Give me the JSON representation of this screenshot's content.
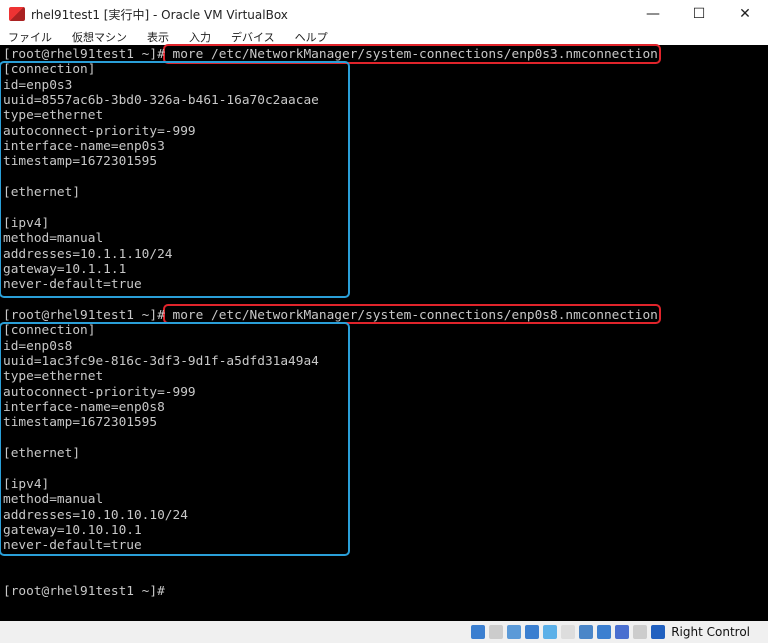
{
  "window": {
    "title": "rhel91test1 [実行中] - Oracle VM VirtualBox",
    "minimize": "—",
    "maximize": "☐",
    "close": "✕"
  },
  "menu": [
    "ファイル",
    "仮想マシン",
    "表示",
    "入力",
    "デバイス",
    "ヘルプ"
  ],
  "terminal": {
    "lines": [
      "[root@rhel91test1 ~]# more /etc/NetworkManager/system-connections/enp0s3.nmconnection",
      "[connection]",
      "id=enp0s3",
      "uuid=8557ac6b-3bd0-326a-b461-16a70c2aacae",
      "type=ethernet",
      "autoconnect-priority=-999",
      "interface-name=enp0s3",
      "timestamp=1672301595",
      "",
      "[ethernet]",
      "",
      "[ipv4]",
      "method=manual",
      "addresses=10.1.1.10/24",
      "gateway=10.1.1.1",
      "never-default=true",
      "",
      "[root@rhel91test1 ~]# more /etc/NetworkManager/system-connections/enp0s8.nmconnection",
      "[connection]",
      "id=enp0s8",
      "uuid=1ac3fc9e-816c-3df3-9d1f-a5dfd31a49a4",
      "type=ethernet",
      "autoconnect-priority=-999",
      "interface-name=enp0s8",
      "timestamp=1672301595",
      "",
      "[ethernet]",
      "",
      "[ipv4]",
      "method=manual",
      "addresses=10.10.10.10/24",
      "gateway=10.10.10.1",
      "never-default=true",
      "",
      "",
      "[root@rhel91test1 ~]# "
    ]
  },
  "statusbar": {
    "host_key": "Right Control",
    "icons": [
      "hard-disk-icon",
      "optical-drive-icon",
      "audio-icon",
      "network-icon",
      "usb-icon",
      "shared-folders-icon",
      "display-icon",
      "video-capture-icon",
      "virtualization-icon",
      "mouse-integration-icon",
      "keyboard-icon"
    ]
  },
  "colors": {
    "highlight_command": "#e0242b",
    "highlight_output": "#2a9fd8"
  }
}
